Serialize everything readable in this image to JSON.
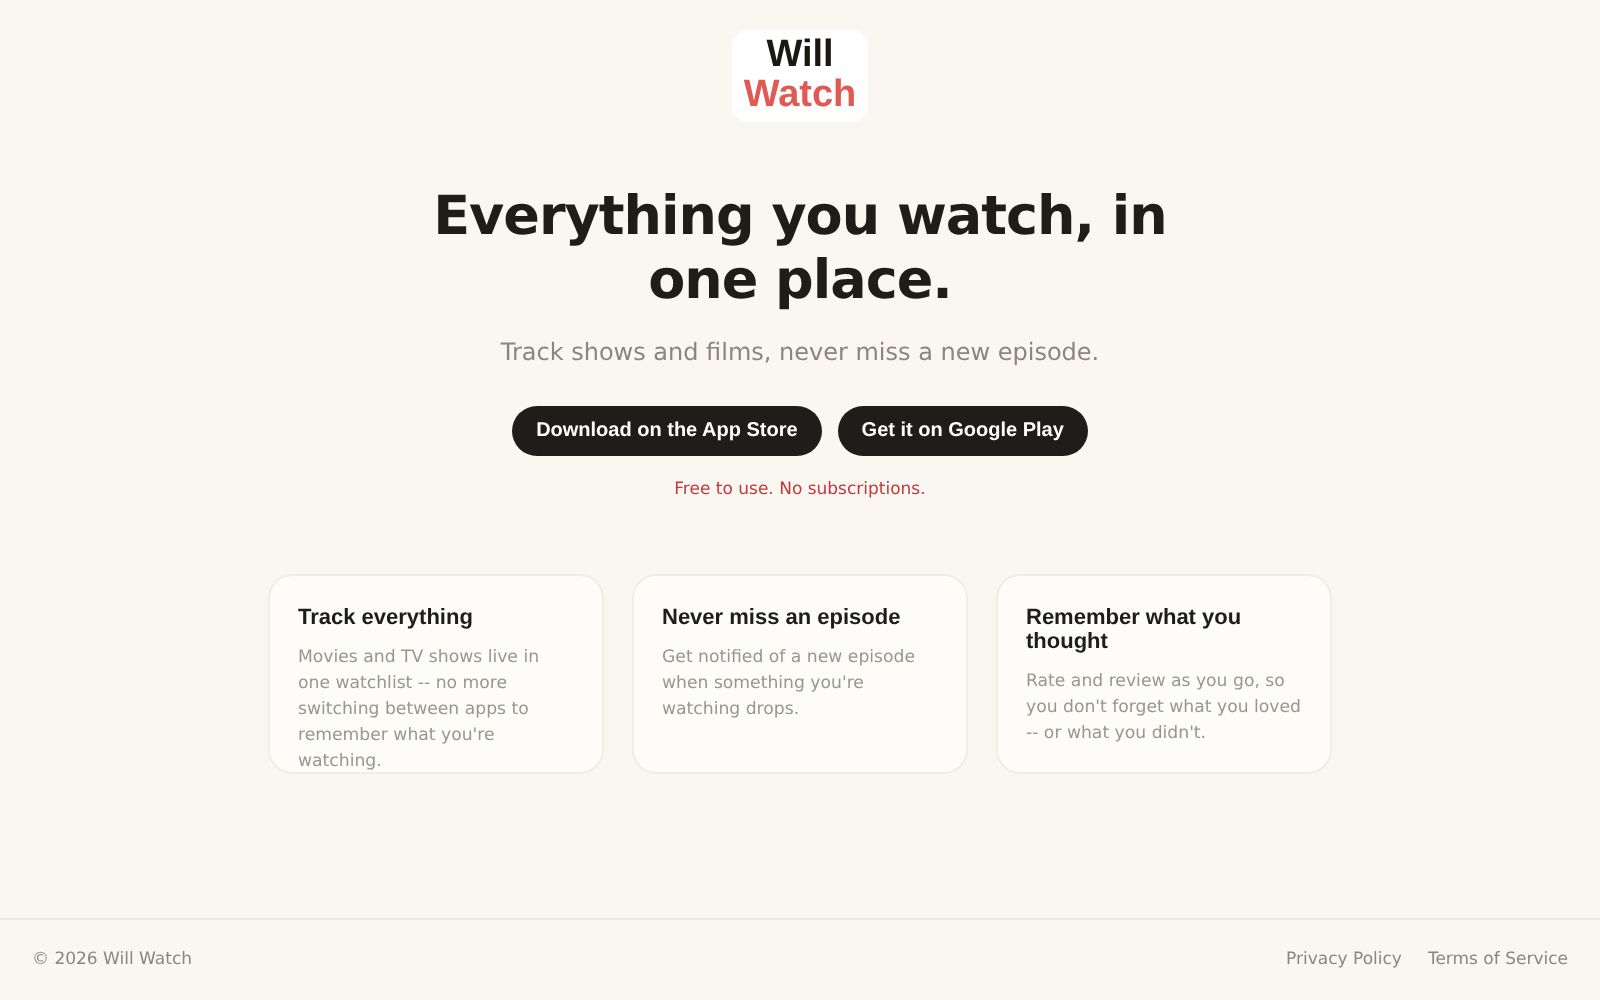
{
  "logo": {
    "line_1": "Will",
    "line_2": "Watch"
  },
  "hero": {
    "title": "Everything you watch, in one place.",
    "subtitle": "Track shows and films, never miss a new episode.",
    "buttons": [
      "Download on the App Store",
      "Get it on Google Play"
    ],
    "note": "Free to use. No subscriptions."
  },
  "features": [
    {
      "title": "Track everything",
      "text": "Movies and TV shows live in one watchlist -- no more switching between apps to remember what you're watching."
    },
    {
      "title": "Never miss an episode",
      "text": "Get notified of a new episode when something you're watching drops."
    },
    {
      "title": "Remember what you thought",
      "text": "Rate and review as you go, so you don't forget what you loved -- or what you didn't."
    }
  ],
  "footer": {
    "copyright": "© 2026 Will Watch",
    "links": [
      "Privacy Policy",
      "Terms of Service"
    ]
  }
}
